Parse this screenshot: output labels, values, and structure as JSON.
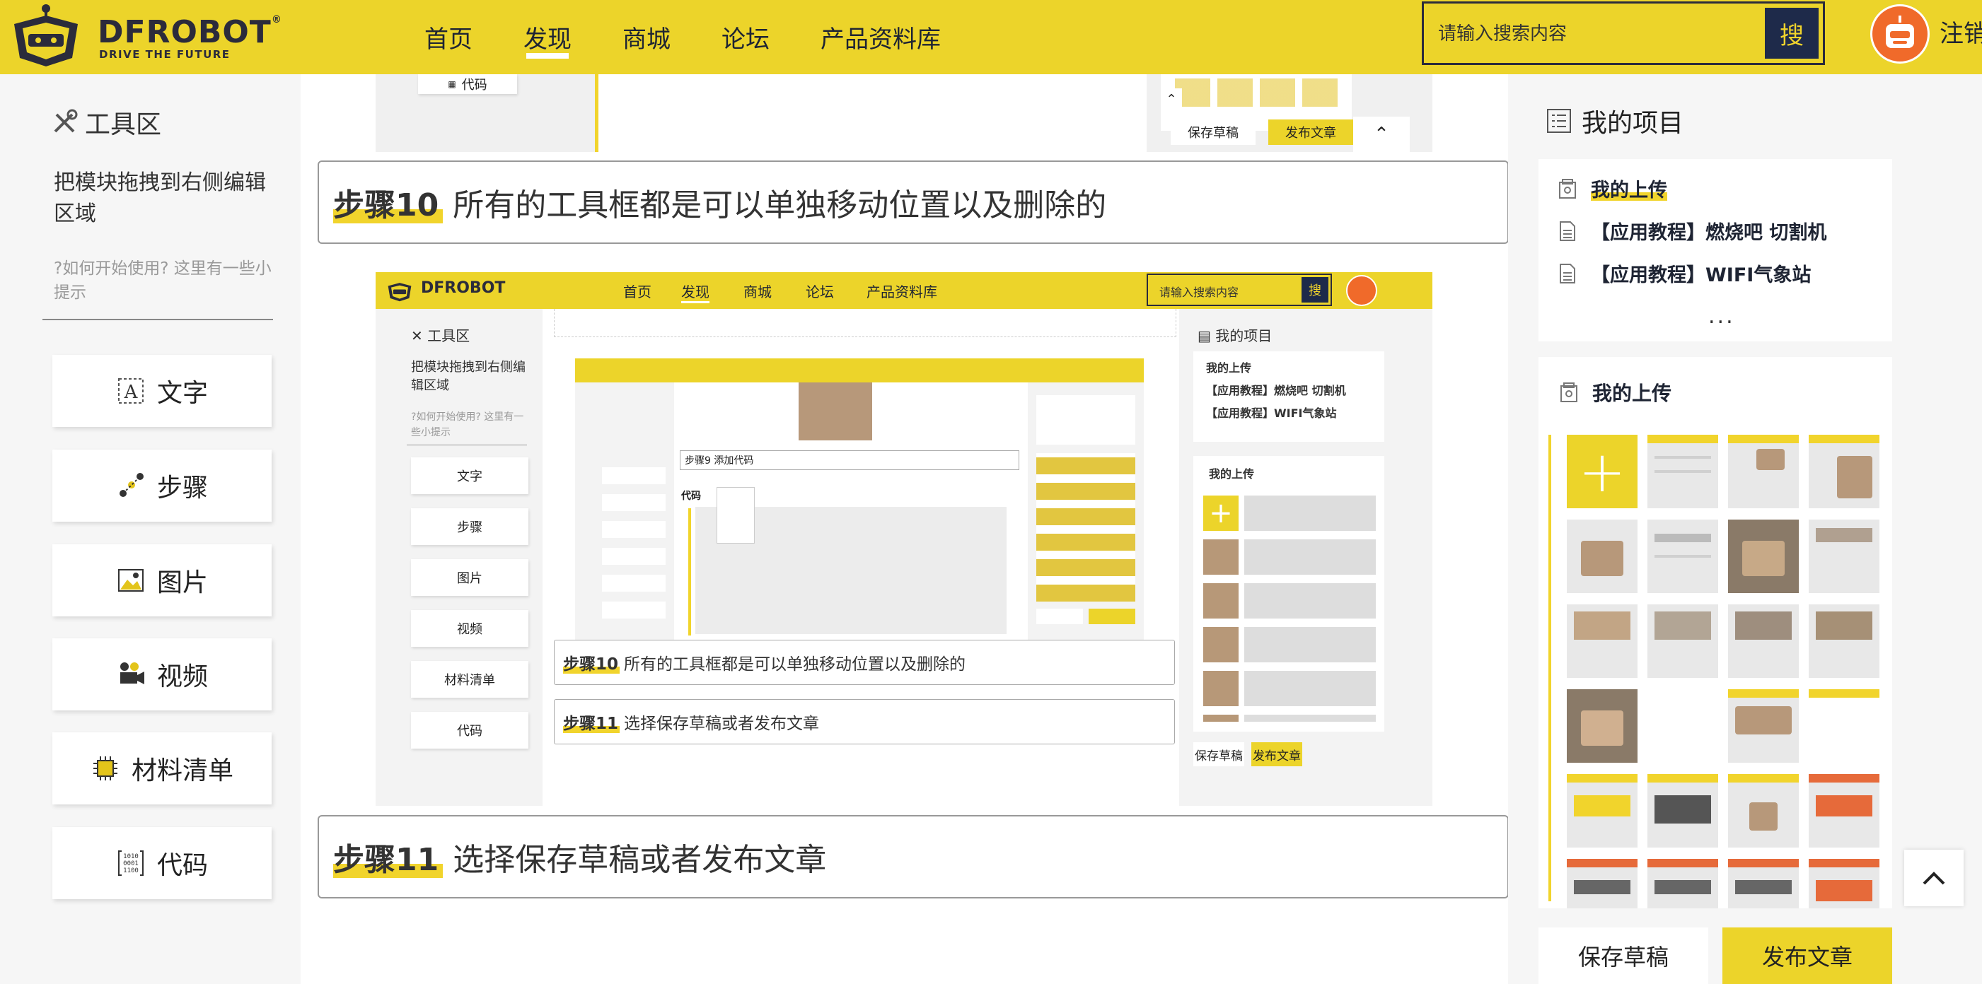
{
  "header": {
    "logo_text": "DFROBOT",
    "logo_tagline": "DRIVE THE FUTURE",
    "nav": [
      "首页",
      "发现",
      "商城",
      "论坛",
      "产品资料库"
    ],
    "active_nav": "发现",
    "search_placeholder": "请输入搜索内容",
    "search_button": "搜",
    "logout_label": "注销"
  },
  "toolbox": {
    "title": "工具区",
    "description": "把模块拖拽到右侧编辑区域",
    "tip": "?如何开始使用? 这里有一些小提示",
    "tools": [
      {
        "label": "文字",
        "icon": "text-icon"
      },
      {
        "label": "步骤",
        "icon": "steps-icon"
      },
      {
        "label": "图片",
        "icon": "image-icon"
      },
      {
        "label": "视频",
        "icon": "video-icon"
      },
      {
        "label": "材料清单",
        "icon": "chip-icon"
      },
      {
        "label": "代码",
        "icon": "code-icon"
      }
    ]
  },
  "main": {
    "top_crop": {
      "code_tool": "代码",
      "save_draft": "保存草稿",
      "publish": "发布文章"
    },
    "steps": [
      {
        "tag": "步骤10",
        "text": "所有的工具框都是可以单独移动位置以及删除的"
      },
      {
        "tag": "步骤11",
        "text": "选择保存草稿或者发布文章"
      }
    ],
    "embedded": {
      "nav": [
        "首页",
        "发现",
        "商城",
        "论坛",
        "产品资料库"
      ],
      "search_placeholder": "请输入搜索内容",
      "search_button": "搜",
      "toolbox_title": "工具区",
      "toolbox_desc": "把模块拖拽到右侧编辑区域",
      "toolbox_tip": "?如何开始使用? 这里有一些小提示",
      "tools": [
        "文字",
        "步骤",
        "图片",
        "视频",
        "材料清单",
        "代码"
      ],
      "projects_title": "我的项目",
      "uploads_title": "我的上传",
      "project_items": [
        "我的上传",
        "【应用教程】燃烧吧 切割机",
        "【应用教程】WIFI气象站"
      ],
      "inner_step9": "步骤9 添加代码",
      "inner_code_label": "代码",
      "step10_tag": "步骤10",
      "step10_text": "所有的工具框都是可以单独移动位置以及删除的",
      "step11_tag": "步骤11",
      "step11_text": "选择保存草稿或者发布文章",
      "save_draft": "保存草稿",
      "publish": "发布文章"
    }
  },
  "projects": {
    "title": "我的项目",
    "items": [
      "我的上传",
      "【应用教程】燃烧吧 切割机",
      "【应用教程】WIFI气象站"
    ],
    "more": "..."
  },
  "uploads": {
    "title": "我的上传"
  },
  "actions": {
    "save_draft": "保存草稿",
    "publish": "发布文章"
  },
  "colors": {
    "brand_yellow": "#ecd42a",
    "navy": "#1e2a4a",
    "avatar_orange": "#f06a2a"
  }
}
